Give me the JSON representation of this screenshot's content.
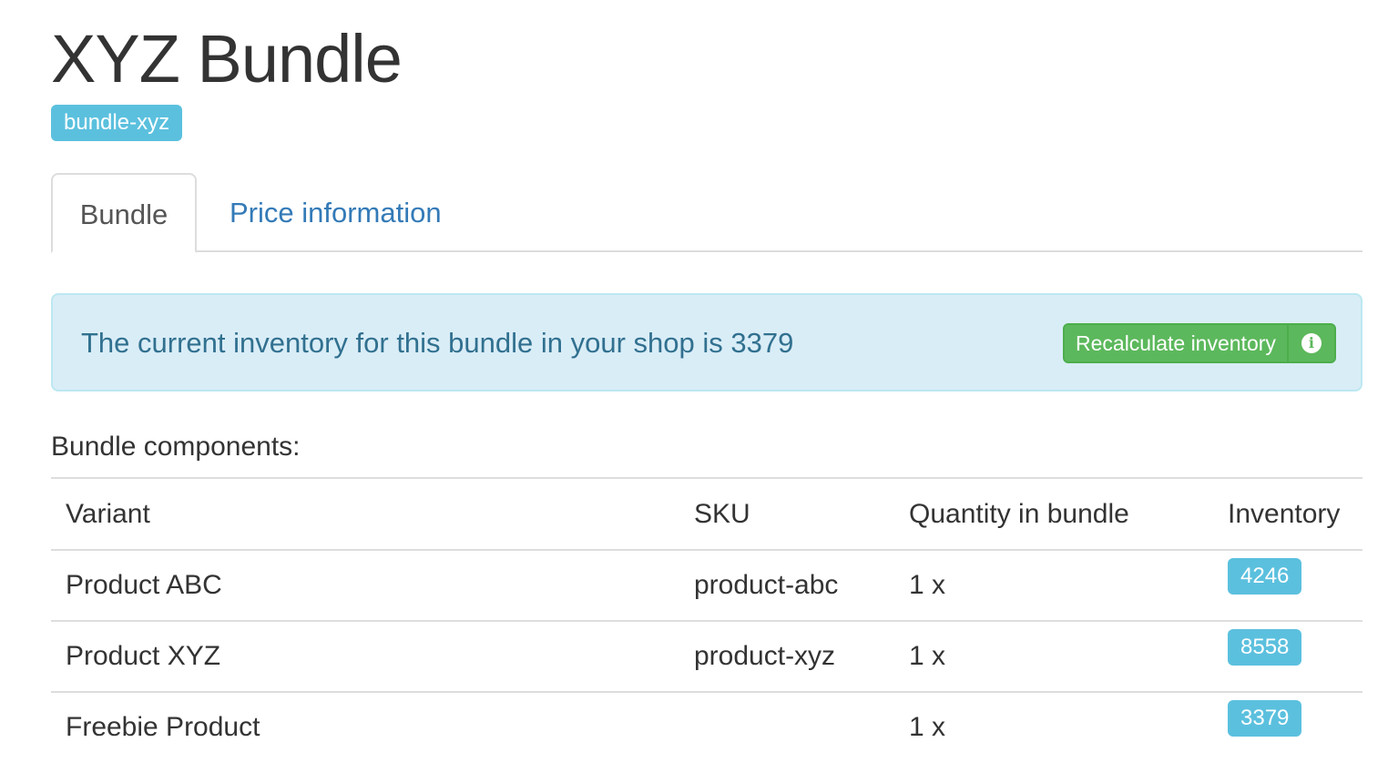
{
  "page": {
    "title": "XYZ Bundle",
    "handle_badge": "bundle-xyz"
  },
  "tabs": [
    {
      "label": "Bundle",
      "active": true
    },
    {
      "label": "Price information",
      "active": false
    }
  ],
  "alert": {
    "text": "The current inventory for this bundle in your shop is 3379",
    "button_label": "Recalculate inventory",
    "info_icon": "info-circle-icon"
  },
  "components": {
    "label": "Bundle components:",
    "columns": [
      "Variant",
      "SKU",
      "Quantity in bundle",
      "Inventory"
    ],
    "rows": [
      {
        "variant": "Product ABC",
        "sku": "product-abc",
        "quantity": "1 x",
        "inventory": "4246"
      },
      {
        "variant": "Product XYZ",
        "sku": "product-xyz",
        "quantity": "1 x",
        "inventory": "8558"
      },
      {
        "variant": "Freebie Product",
        "sku": "",
        "quantity": "1 x",
        "inventory": "3379"
      }
    ]
  },
  "colors": {
    "badge": "#5bc0de",
    "link": "#337ab7",
    "alert_bg": "#d9edf7",
    "alert_text": "#31708f",
    "success": "#5cb85c"
  }
}
